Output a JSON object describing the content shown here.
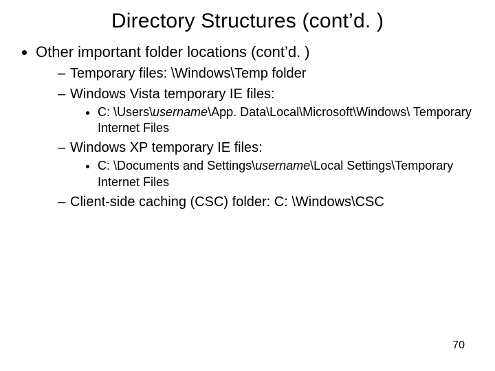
{
  "title": "Directory Structures (cont’d. )",
  "bullets": {
    "l1_0": "Other important folder locations (cont’d. )",
    "l2_0": "Temporary files: \\Windows\\Temp folder",
    "l2_1": "Windows Vista temporary IE files:",
    "l3_0_pre": "C: \\Users\\",
    "l3_0_em": "username",
    "l3_0_post": "\\App. Data\\Local\\Microsoft\\Windows\\ Temporary Internet Files",
    "l2_2": "Windows XP temporary IE files:",
    "l3_1_pre": "C: \\Documents and Settings\\",
    "l3_1_em": "username",
    "l3_1_post": "\\Local Settings\\Temporary Internet Files",
    "l2_3": "Client-side caching (CSC) folder: C: \\Windows\\CSC"
  },
  "page_number": "70"
}
